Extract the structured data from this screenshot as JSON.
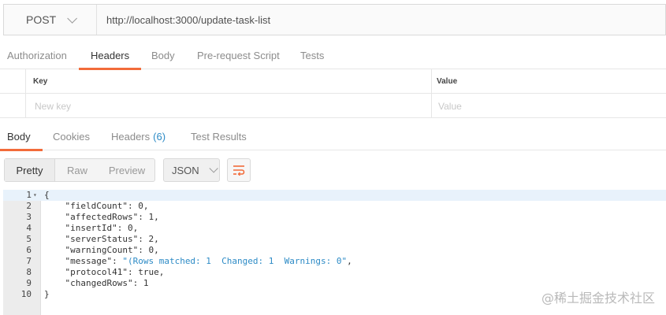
{
  "request": {
    "method": "POST",
    "url": "http://localhost:3000/update-task-list"
  },
  "request_tabs": [
    {
      "label": "Authorization",
      "active": false
    },
    {
      "label": "Headers",
      "active": true
    },
    {
      "label": "Body",
      "active": false
    },
    {
      "label": "Pre-request Script",
      "active": false
    },
    {
      "label": "Tests",
      "active": false
    }
  ],
  "headers_table": {
    "key_header": "Key",
    "value_header": "Value",
    "key_placeholder": "New key",
    "value_placeholder": "Value"
  },
  "response_tabs": {
    "body": "Body",
    "cookies": "Cookies",
    "headers": "Headers",
    "headers_count": "(6)",
    "test_results": "Test Results"
  },
  "view_modes": [
    "Pretty",
    "Raw",
    "Preview"
  ],
  "format": "JSON",
  "icons": {
    "method_dropdown": "chevron-down-icon",
    "format_dropdown": "chevron-down-icon",
    "wrap": "wrap-lines-icon",
    "fold": "fold-arrow-icon"
  },
  "colors": {
    "accent": "#f26b3a",
    "count": "#2d8bc6",
    "string": "#2d8bc6"
  },
  "code_lines": [
    {
      "num": "1",
      "text": "{"
    },
    {
      "num": "2",
      "text": "    \"fieldCount\": 0,"
    },
    {
      "num": "3",
      "text": "    \"affectedRows\": 1,"
    },
    {
      "num": "4",
      "text": "    \"insertId\": 0,"
    },
    {
      "num": "5",
      "text": "    \"serverStatus\": 2,"
    },
    {
      "num": "6",
      "text": "    \"warningCount\": 0,"
    },
    {
      "num": "7",
      "text": "    \"message\": \"(Rows matched: 1  Changed: 1  Warnings: 0\","
    },
    {
      "num": "8",
      "text": "    \"protocol41\": true,"
    },
    {
      "num": "9",
      "text": "    \"changedRows\": 1"
    },
    {
      "num": "10",
      "text": "}"
    }
  ],
  "watermark": "@稀土掘金技术社区"
}
